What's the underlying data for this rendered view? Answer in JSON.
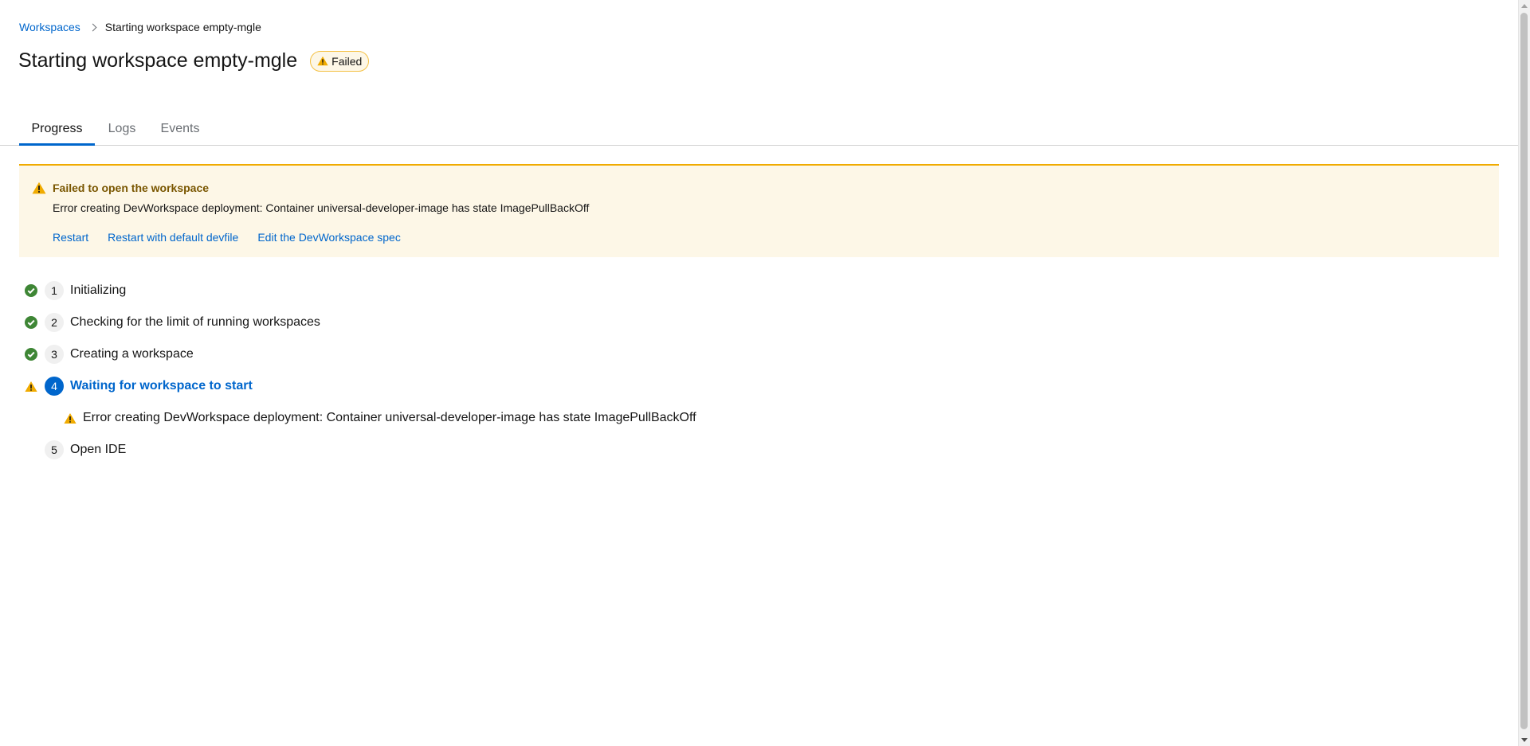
{
  "breadcrumb": {
    "root": "Workspaces",
    "current": "Starting workspace empty-mgle"
  },
  "header": {
    "title": "Starting workspace empty-mgle",
    "status_badge": "Failed"
  },
  "tabs": [
    {
      "label": "Progress",
      "active": true
    },
    {
      "label": "Logs",
      "active": false
    },
    {
      "label": "Events",
      "active": false
    }
  ],
  "alert": {
    "title": "Failed to open the workspace",
    "description": "Error creating DevWorkspace deployment: Container universal-developer-image has state ImagePullBackOff",
    "actions": [
      {
        "label": "Restart"
      },
      {
        "label": "Restart with default devfile"
      },
      {
        "label": "Edit the DevWorkspace spec"
      }
    ]
  },
  "steps": [
    {
      "number": "1",
      "label": "Initializing",
      "status": "success"
    },
    {
      "number": "2",
      "label": "Checking for the limit of running workspaces",
      "status": "success"
    },
    {
      "number": "3",
      "label": "Creating a workspace",
      "status": "success"
    },
    {
      "number": "4",
      "label": "Waiting for workspace to start",
      "status": "warning"
    },
    {
      "number": "5",
      "label": "Open IDE",
      "status": "pending"
    }
  ],
  "step_error": "Error creating DevWorkspace deployment: Container universal-developer-image has state ImagePullBackOff",
  "colors": {
    "link": "#0066cc",
    "success": "#3e8635",
    "warning": "#f0ab00",
    "alert_bg": "#fdf7e7",
    "alert_title": "#795600"
  }
}
